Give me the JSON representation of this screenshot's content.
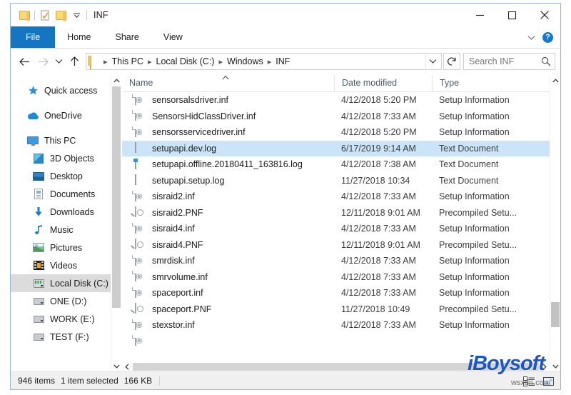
{
  "window": {
    "title": "INF",
    "quick_access": [
      "folder-icon",
      "properties-icon",
      "new-folder-icon",
      "customize-dropdown-icon"
    ],
    "controls": {
      "minimize": "minimize-icon",
      "maximize": "maximize-icon",
      "close": "close-icon"
    }
  },
  "ribbon": {
    "tabs": [
      {
        "label": "File",
        "active": true
      },
      {
        "label": "Home",
        "active": false
      },
      {
        "label": "Share",
        "active": false
      },
      {
        "label": "View",
        "active": false
      }
    ],
    "collapse_icon": "chevron-down-icon",
    "help_label": "?"
  },
  "address": {
    "back_icon": "arrow-left-icon",
    "forward_icon": "arrow-right-icon",
    "recent_icon": "chevron-down-icon",
    "up_icon": "arrow-up-icon",
    "folder_icon": "folder-icon",
    "breadcrumb": [
      "This PC",
      "Local Disk (C:)",
      "Windows",
      "INF"
    ],
    "path_dropdown_icon": "chevron-down-icon",
    "refresh_icon": "refresh-icon",
    "search_placeholder": "Search INF",
    "search_value": "",
    "search_icon": "search-icon"
  },
  "sidebar": {
    "items": [
      {
        "label": "Quick access",
        "icon": "star-icon",
        "indent": false,
        "selected": false,
        "gap_after": true
      },
      {
        "label": "OneDrive",
        "icon": "cloud-icon",
        "indent": false,
        "selected": false,
        "gap_after": true
      },
      {
        "label": "This PC",
        "icon": "monitor-icon",
        "indent": false,
        "selected": false,
        "gap_after": false
      },
      {
        "label": "3D Objects",
        "icon": "cube-icon",
        "indent": true,
        "selected": false,
        "gap_after": false
      },
      {
        "label": "Desktop",
        "icon": "desktop-icon",
        "indent": true,
        "selected": false,
        "gap_after": false
      },
      {
        "label": "Documents",
        "icon": "documents-icon",
        "indent": true,
        "selected": false,
        "gap_after": false
      },
      {
        "label": "Downloads",
        "icon": "download-arrow-icon",
        "indent": true,
        "selected": false,
        "gap_after": false
      },
      {
        "label": "Music",
        "icon": "music-note-icon",
        "indent": true,
        "selected": false,
        "gap_after": false
      },
      {
        "label": "Pictures",
        "icon": "picture-icon",
        "indent": true,
        "selected": false,
        "gap_after": false
      },
      {
        "label": "Videos",
        "icon": "video-icon",
        "indent": true,
        "selected": false,
        "gap_after": false
      },
      {
        "label": "Local Disk (C:)",
        "icon": "hard-disk-icon",
        "indent": true,
        "selected": true,
        "gap_after": false
      },
      {
        "label": "ONE (D:)",
        "icon": "drive-icon",
        "indent": true,
        "selected": false,
        "gap_after": false
      },
      {
        "label": "WORK (E:)",
        "icon": "drive-icon",
        "indent": true,
        "selected": false,
        "gap_after": false
      },
      {
        "label": "TEST (F:)",
        "icon": "drive-icon",
        "indent": true,
        "selected": false,
        "gap_after": false
      }
    ],
    "scroll_up_icon": "chevron-up-icon",
    "scroll_down_icon": "chevron-down-icon"
  },
  "filelist": {
    "columns": [
      {
        "label": "Name",
        "sort": "ascending"
      },
      {
        "label": "Date modified",
        "sort": ""
      },
      {
        "label": "Type",
        "sort": ""
      }
    ],
    "sort_indicator_icon": "chevron-up-icon",
    "column_expand_icon": "chevron-up-icon",
    "rows": [
      {
        "name": "sensorsalsdriver.inf",
        "date": "4/12/2018 5:20 PM",
        "type": "Setup Information",
        "icon": "inf-file-icon",
        "selected": false
      },
      {
        "name": "SensorsHidClassDriver.inf",
        "date": "4/12/2018 7:33 AM",
        "type": "Setup Information",
        "icon": "inf-file-icon",
        "selected": false
      },
      {
        "name": "sensorsservicedriver.inf",
        "date": "4/12/2018 5:20 PM",
        "type": "Setup Information",
        "icon": "inf-file-icon",
        "selected": false
      },
      {
        "name": "setupapi.dev.log",
        "date": "6/17/2019 9:14 AM",
        "type": "Text Document",
        "icon": "text-file-icon",
        "selected": true
      },
      {
        "name": "setupapi.offline.20180411_163816.log",
        "date": "4/12/2018 7:38 AM",
        "type": "Text Document",
        "icon": "text-file-new-icon",
        "selected": false
      },
      {
        "name": "setupapi.setup.log",
        "date": "11/27/2018 10:34",
        "type": "Text Document",
        "icon": "text-file-icon",
        "selected": false
      },
      {
        "name": "sisraid2.inf",
        "date": "4/12/2018 7:33 AM",
        "type": "Setup Information",
        "icon": "inf-file-icon",
        "selected": false
      },
      {
        "name": "sisraid2.PNF",
        "date": "12/11/2018 9:01 AM",
        "type": "Precompiled Setu...",
        "icon": "pnf-file-icon",
        "selected": false
      },
      {
        "name": "sisraid4.inf",
        "date": "4/12/2018 7:33 AM",
        "type": "Setup Information",
        "icon": "inf-file-icon",
        "selected": false
      },
      {
        "name": "sisraid4.PNF",
        "date": "12/11/2018 9:01 AM",
        "type": "Precompiled Setu...",
        "icon": "pnf-file-icon",
        "selected": false
      },
      {
        "name": "smrdisk.inf",
        "date": "4/12/2018 7:33 AM",
        "type": "Setup Information",
        "icon": "inf-file-icon",
        "selected": false
      },
      {
        "name": "smrvolume.inf",
        "date": "4/12/2018 7:33 AM",
        "type": "Setup Information",
        "icon": "inf-file-icon",
        "selected": false
      },
      {
        "name": "spaceport.inf",
        "date": "4/12/2018 7:33 AM",
        "type": "Setup Information",
        "icon": "inf-file-icon",
        "selected": false
      },
      {
        "name": "spaceport.PNF",
        "date": "11/27/2018 10:49",
        "type": "Precompiled Setu...",
        "icon": "pnf-file-icon",
        "selected": false
      },
      {
        "name": "stexstor.inf",
        "date": "4/12/2018 7:33 AM",
        "type": "Setup Information",
        "icon": "inf-file-icon",
        "selected": false
      }
    ],
    "scroll_up_icon": "chevron-up-icon",
    "scroll_down_icon": "chevron-down-icon",
    "hscroll_left_icon": "chevron-left-icon",
    "hscroll_right_icon": "chevron-right-icon"
  },
  "statusbar": {
    "item_count": "946 items",
    "selection": "1 item selected",
    "selection_size": "166 KB",
    "details_view_icon": "details-view-icon",
    "large_icons_view_icon": "large-icons-view-icon"
  },
  "watermark": {
    "brand": "iBoysoft",
    "sub": "wsxdn.com"
  },
  "colors": {
    "accent": "#1675c0",
    "selection": "#cbe4f7",
    "sidebar_selection": "#dcdcdc",
    "brand": "#1b56c4"
  }
}
